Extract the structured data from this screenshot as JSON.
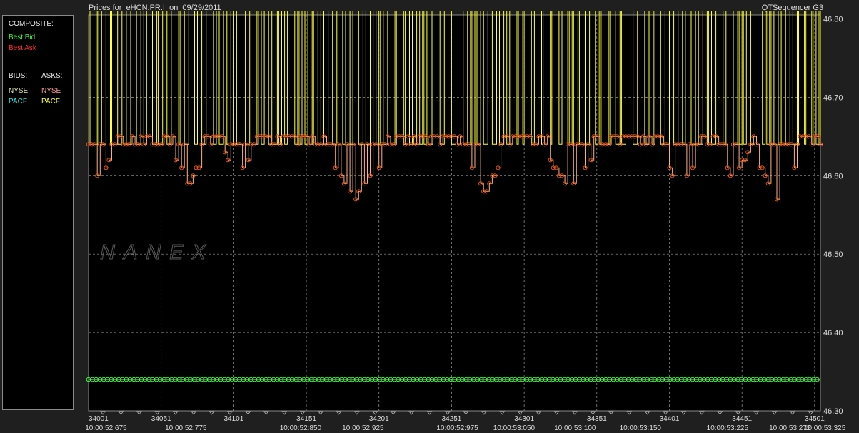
{
  "header": {
    "title": "Prices for  eHCN.PR.I  on  09/29/2011",
    "app": "QTSequencer G3"
  },
  "legend": {
    "composite_label": "COMPOSITE:",
    "best_bid": "Best Bid",
    "best_ask": "Best Ask",
    "bids_label": "BIDS:",
    "asks_label": "ASKS:",
    "bids": [
      "NYSE",
      "PACF"
    ],
    "asks": [
      "NYSE",
      "PACF"
    ]
  },
  "watermark": "NANEX",
  "colors": {
    "background": "#000000",
    "panel": "#1f1f1f",
    "grid": "#9a9a9a",
    "best_bid": "#33ff33",
    "best_ask": "#ff3333",
    "nyse_bid": "#e6e6b0",
    "pacf_bid": "#33e6e6",
    "nyse_ask": "#ff9c9c",
    "pacf_ask": "#ffff33",
    "nyse_ask_line": "#ffb080",
    "ask_marker": "#e05010",
    "bid_line": "#bfe8e8"
  },
  "chart_data": {
    "type": "line",
    "y_ticks": [
      "46.80",
      "46.70",
      "46.60",
      "46.50",
      "46.40",
      "46.30"
    ],
    "y_tick_values": [
      46.8,
      46.7,
      46.6,
      46.5,
      46.4,
      46.3
    ],
    "ylim": [
      46.3,
      46.805
    ],
    "x_seq_ticks": [
      "34001",
      "34051",
      "34101",
      "34151",
      "34201",
      "34251",
      "34301",
      "34351",
      "34401",
      "34451",
      "34501"
    ],
    "x_seq_values": [
      34001,
      34051,
      34101,
      34151,
      34201,
      34251,
      34301,
      34351,
      34401,
      34451,
      34501
    ],
    "xlim": [
      34001,
      34505
    ],
    "x_time_ticks": [
      "10:00:52:675",
      "10:00:52:775",
      "10:00:52:850",
      "10:00:52:925",
      "10:00:52:975",
      "10:00:53:050",
      "10:00:53:100",
      "10:00:53:150",
      "10:00:53:225",
      "10:00:53:275",
      "10:00:53:325"
    ],
    "x_time_seq": [
      34013,
      34068,
      34147,
      34190,
      34255,
      34294,
      34336,
      34381,
      34441,
      34484,
      34508
    ],
    "grid": true,
    "series": [
      {
        "name": "PACF",
        "side": "ask",
        "values_summary": "alternates between 46.81 and 46.64 throughout",
        "high": 46.81,
        "low": 46.64
      },
      {
        "name": "NYSE",
        "side": "ask",
        "values_summary": "mostly 46.64-46.65 with dips down to 46.57",
        "base": [
          46.64,
          46.65
        ],
        "dips": [
          {
            "start": 34001,
            "end": 34016,
            "min": 46.59
          },
          {
            "start": 34061,
            "end": 34079,
            "min": 46.59
          },
          {
            "start": 34095,
            "end": 34112,
            "min": 46.6
          },
          {
            "start": 34167,
            "end": 34203,
            "min": 46.57
          },
          {
            "start": 34263,
            "end": 34285,
            "min": 46.58
          },
          {
            "start": 34318,
            "end": 34348,
            "min": 46.58
          },
          {
            "start": 34398,
            "end": 34418,
            "min": 46.58
          },
          {
            "start": 34434,
            "end": 34455,
            "min": 46.6
          },
          {
            "start": 34462,
            "end": 34488,
            "min": 46.57
          }
        ]
      },
      {
        "name": "NYSE",
        "side": "bid",
        "value": 46.34
      },
      {
        "name": "Best Bid",
        "side": "bid",
        "value": 46.34
      }
    ]
  }
}
